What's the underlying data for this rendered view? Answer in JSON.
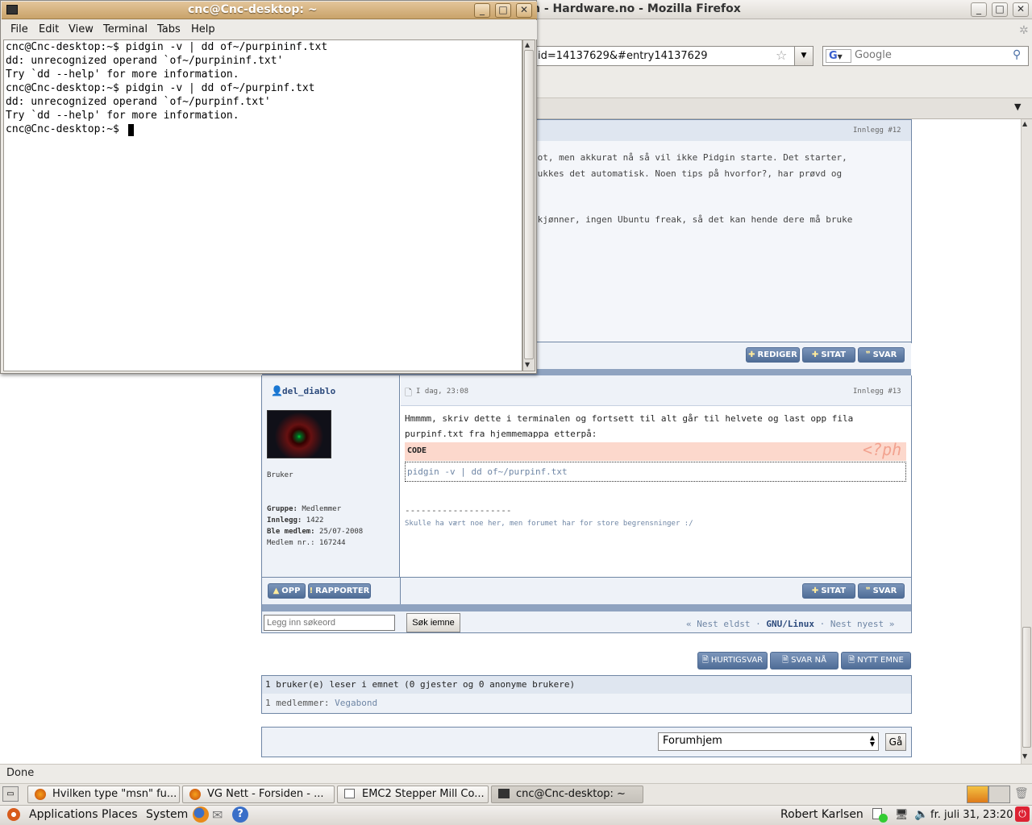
{
  "firefox": {
    "title_visible": "h - Hardware.no - Mozilla Firefox",
    "url": "id=14137629&#entry14137629",
    "search_placeholder": "Google",
    "status": "Done"
  },
  "forum": {
    "post12": {
      "num": "Innlegg #12",
      "lines": [
        "hot, men akkurat nå så vil ikke Pidgin starte. Det starter,",
        "lukkes det automatisk. Noen tips på hvorfor?, har prøvd og",
        "skjønner, ingen Ubuntu freak, så det kan hende dere må bruke"
      ],
      "buttons": {
        "edit": "REDIGER",
        "quote": "SITAT",
        "reply": "SVAR"
      }
    },
    "post13": {
      "author": "del_diablo",
      "time": "I dag, 23:08",
      "num": "Innlegg #13",
      "rank": "Bruker",
      "group_label": "Gruppe:",
      "group": "Medlemmer",
      "posts_label": "Innlegg:",
      "posts": "1422",
      "joined_label": "Ble medlem:",
      "joined": "25/07-2008",
      "member_no_label": "Medlem nr.:",
      "member_no": "167244",
      "body1": "Hmmmm, skriv dette i terminalen og fortsett til alt går til helvete og last opp fila",
      "body2": "purpinf.txt fra hjemmemappa etterpå:",
      "code_label": "CODE",
      "code_watermark": "<?ph",
      "code": "pidgin -v | dd of~/purpinf.txt",
      "sig_line": "--------------------",
      "sig": "Skulle ha vært noe her, men forumet har for store begrensninger :/",
      "buttons": {
        "up": "OPP",
        "report": "RAPPORTER",
        "quote": "SITAT",
        "reply": "SVAR"
      }
    },
    "search_placeholder": "Legg inn søkeord",
    "search_button": "Søk iemne",
    "nav_prev": "« Nest eldst",
    "nav_sep1": "·",
    "nav_forum": "GNU/Linux",
    "nav_sep2": "·",
    "nav_next": "Nest nyest »",
    "action_quick": "HURTIGSVAR",
    "action_reply": "SVAR NÅ",
    "action_new": "NYTT EMNE",
    "readers": "1 bruker(e) leser i emnet (0 gjester og 0 anonyme brukere)",
    "members_label": "1 medlemmer:",
    "member": "Vegabond",
    "jump_select": "Forumhjem",
    "jump_button": "Gå"
  },
  "terminal": {
    "title": "cnc@Cnc-desktop: ~",
    "menus": [
      "File",
      "Edit",
      "View",
      "Terminal",
      "Tabs",
      "Help"
    ],
    "lines": [
      "cnc@Cnc-desktop:~$ pidgin -v | dd of~/purpininf.txt",
      "dd: unrecognized operand `of~/purpininf.txt'",
      "Try `dd --help' for more information.",
      "cnc@Cnc-desktop:~$ pidgin -v | dd of~/purpinf.txt",
      "dd: unrecognized operand `of~/purpinf.txt'",
      "Try `dd --help' for more information.",
      "cnc@Cnc-desktop:~$ "
    ]
  },
  "taskbar": {
    "tasks": [
      "Hvilken type \"msn\" fu...",
      "VG Nett - Forsiden - ...",
      "EMC2 Stepper Mill Co...",
      "cnc@Cnc-desktop: ~"
    ]
  },
  "panel": {
    "applications": "Applications",
    "places": "Places",
    "system": "System",
    "user": "Robert Karlsen",
    "clock": "fr. juli 31, 23:20"
  }
}
